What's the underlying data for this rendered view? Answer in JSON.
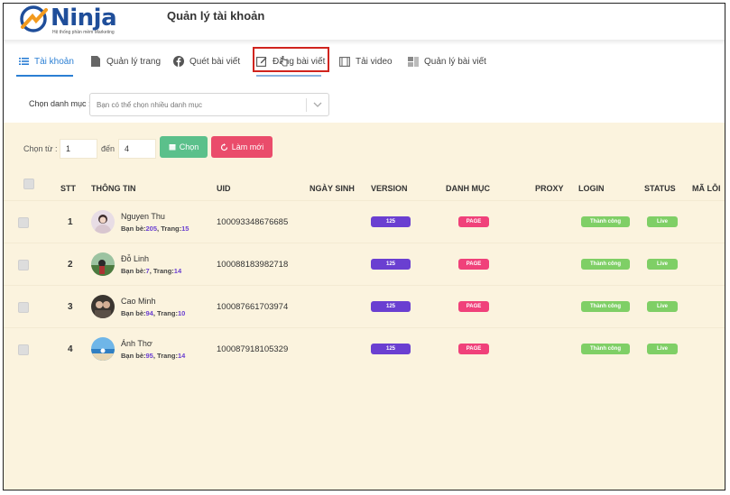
{
  "header": {
    "logo_text": "Ninja",
    "logo_tagline": "Hệ thống phần mềm Marketing",
    "page_title": "Quản lý tài khoản"
  },
  "tabs": [
    {
      "label": "Tài khoản",
      "icon": "list-icon",
      "active": true
    },
    {
      "label": "Quản lý trang",
      "icon": "document-icon",
      "active": false
    },
    {
      "label": "Quét bài viết",
      "icon": "facebook-icon",
      "active": false
    },
    {
      "label": "Đăng bài viết",
      "icon": "edit-icon",
      "active": false,
      "highlighted": true
    },
    {
      "label": "Tải video",
      "icon": "film-icon",
      "active": false
    },
    {
      "label": "Quản lý bài viết",
      "icon": "posts-icon",
      "active": false
    }
  ],
  "filter": {
    "label": "Chọn danh mục :",
    "placeholder": "Bạn có thể chọn nhiều danh mục"
  },
  "range": {
    "from_label": "Chọn từ :",
    "from_value": "1",
    "to_label": "đến",
    "to_value": "4",
    "choose_label": "Chọn",
    "reset_label": "Làm mới"
  },
  "table": {
    "columns": [
      "STT",
      "THÔNG TIN",
      "UID",
      "NGÀY SINH",
      "VERSION",
      "DANH MỤC",
      "PROXY",
      "LOGIN",
      "STATUS",
      "MÃ LỖI"
    ],
    "rows": [
      {
        "stt": "1",
        "name": "Nguyen Thu",
        "friends_label": "Bạn bè:",
        "friends": "205",
        "pages_label": "Trang:",
        "pages": "15",
        "uid": "100093348676685",
        "version": "125",
        "category": "PAGE",
        "login": "Thành công",
        "status": "Live"
      },
      {
        "stt": "2",
        "name": "Đỗ Linh",
        "friends_label": "Bạn bè:",
        "friends": "7",
        "pages_label": "Trang:",
        "pages": "14",
        "uid": "100088183982718",
        "version": "125",
        "category": "PAGE",
        "login": "Thành công",
        "status": "Live"
      },
      {
        "stt": "3",
        "name": "Cao Minh",
        "friends_label": "Bạn bè:",
        "friends": "94",
        "pages_label": "Trang:",
        "pages": "10",
        "uid": "100087661703974",
        "version": "125",
        "category": "PAGE",
        "login": "Thành công",
        "status": "Live"
      },
      {
        "stt": "4",
        "name": "Ánh Thơ",
        "friends_label": "Bạn bè:",
        "friends": "95",
        "pages_label": "Trang:",
        "pages": "14",
        "uid": "100087918105329",
        "version": "125",
        "category": "PAGE",
        "login": "Thành công",
        "status": "Live"
      }
    ]
  },
  "colors": {
    "accent": "#2b7fd4",
    "content_bg": "#fbf3de",
    "version_pill": "#6a3fd1",
    "page_pill": "#f0417a",
    "success_pill": "#7fcf66",
    "highlight_box": "#d0241e"
  }
}
